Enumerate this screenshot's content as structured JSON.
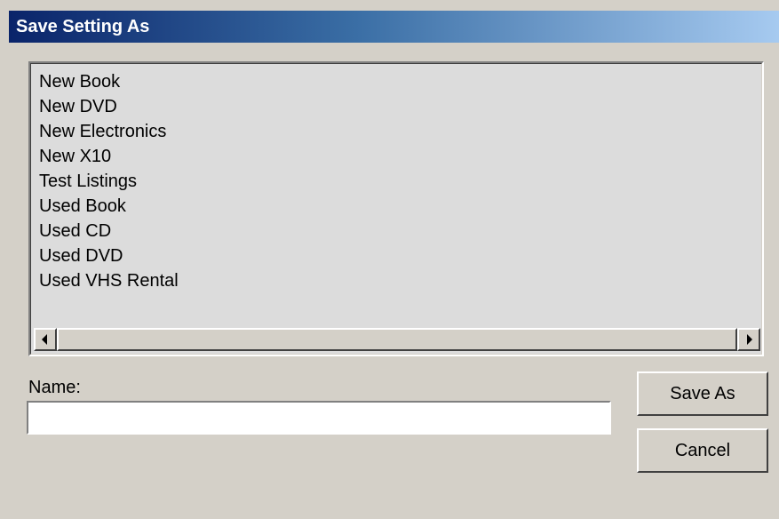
{
  "window": {
    "title": "Save Setting As"
  },
  "settings_list": {
    "items": [
      "New Book",
      "New DVD",
      "New Electronics",
      "New X10",
      "Test Listings",
      "Used Book",
      "Used CD",
      "Used DVD",
      "Used VHS Rental"
    ]
  },
  "name_field": {
    "label": "Name:",
    "value": "",
    "placeholder": ""
  },
  "buttons": {
    "save_as": "Save As",
    "cancel": "Cancel"
  },
  "icons": {
    "scroll_left": "scroll-left-arrow-icon",
    "scroll_right": "scroll-right-arrow-icon"
  },
  "colors": {
    "dialog_bg": "#d4d0c8",
    "titlebar_start": "#0a246a",
    "titlebar_end": "#a6caf0",
    "title_text": "#ffffff"
  }
}
